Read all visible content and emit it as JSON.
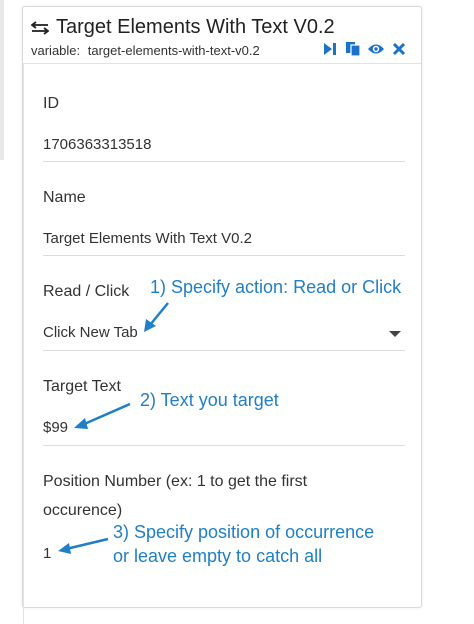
{
  "header": {
    "title": "Target Elements With Text V0.2",
    "variable_label": "variable:",
    "variable_value": "target-elements-with-text-v0.2"
  },
  "icons": {
    "title": "swap-arrows-icon",
    "tools": [
      "skip-forward-icon",
      "copy-icon",
      "eye-icon",
      "close-icon"
    ]
  },
  "fields": {
    "id": {
      "label": "ID",
      "value": "1706363313518"
    },
    "name": {
      "label": "Name",
      "value": "Target Elements With Text V0.2"
    },
    "read_click": {
      "label": "Read / Click",
      "value": "Click New Tab"
    },
    "target_text": {
      "label": "Target Text",
      "value": "$99"
    },
    "position": {
      "label_line1": "Position Number (ex: 1 to get the first",
      "label_line2": "occurence)",
      "value": "1"
    }
  },
  "annotations": {
    "action": "1) Specify action: Read or Click",
    "text": "2) Text you target",
    "position_line1": "3) Specify position of occurrence",
    "position_line2": "or leave empty to catch all"
  },
  "colors": {
    "accent": "#1f7fc7",
    "icon_blue": "#1a73c8"
  }
}
